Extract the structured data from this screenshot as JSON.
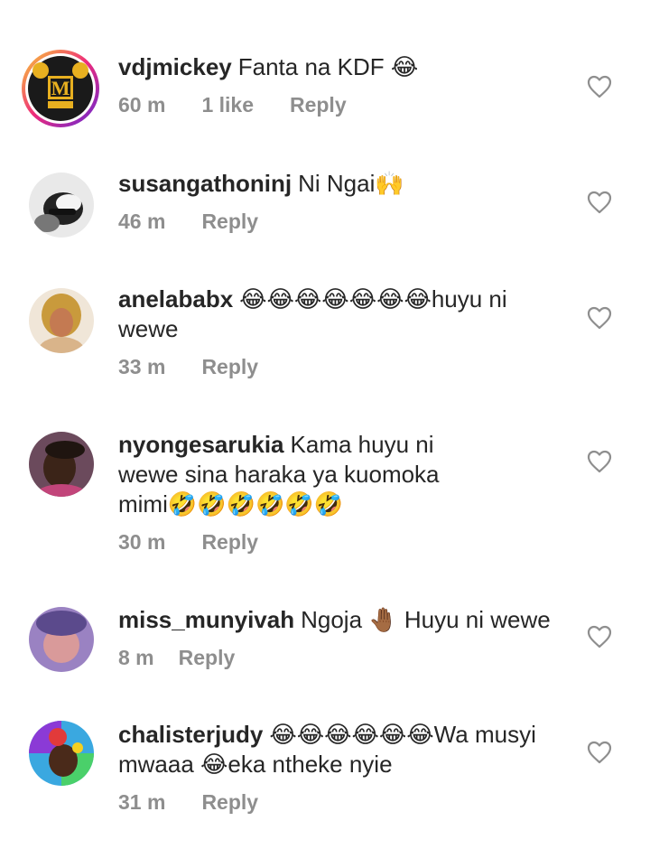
{
  "comments": [
    {
      "username": "vdjmickey",
      "text": "Fanta na KDF 😂",
      "time": "60 m",
      "likes": "1 like",
      "reply": "Reply",
      "avatar_label": "M"
    },
    {
      "username": "susangathoninj",
      "text": "Ni Ngai🙌",
      "time": "46 m",
      "reply": "Reply"
    },
    {
      "username": "anelababx",
      "text": "😂😂😂😂😂😂😂huyu ni wewe",
      "time": "33 m",
      "reply": "Reply"
    },
    {
      "username": "nyongesarukia",
      "text": "Kama huyu ni wewe sina haraka ya kuomoka mimi🤣🤣🤣🤣🤣🤣",
      "time": "30 m",
      "reply": "Reply"
    },
    {
      "username": "miss_munyivah",
      "text": "Ngoja 🤚🏾 Huyu ni wewe",
      "time": "8 m",
      "reply": "Reply"
    },
    {
      "username": "chalisterjudy",
      "text": "😂😂😂😂😂😂Wa musyi mwaaa 😂eka ntheke nyie",
      "time": "31 m",
      "reply": "Reply"
    }
  ],
  "icons": {
    "like": "heart-outline-icon"
  },
  "colors": {
    "text": "#262626",
    "meta": "#8e8e8e",
    "story_ring_start": "#f58529",
    "story_ring_end": "#dd2a7b"
  }
}
